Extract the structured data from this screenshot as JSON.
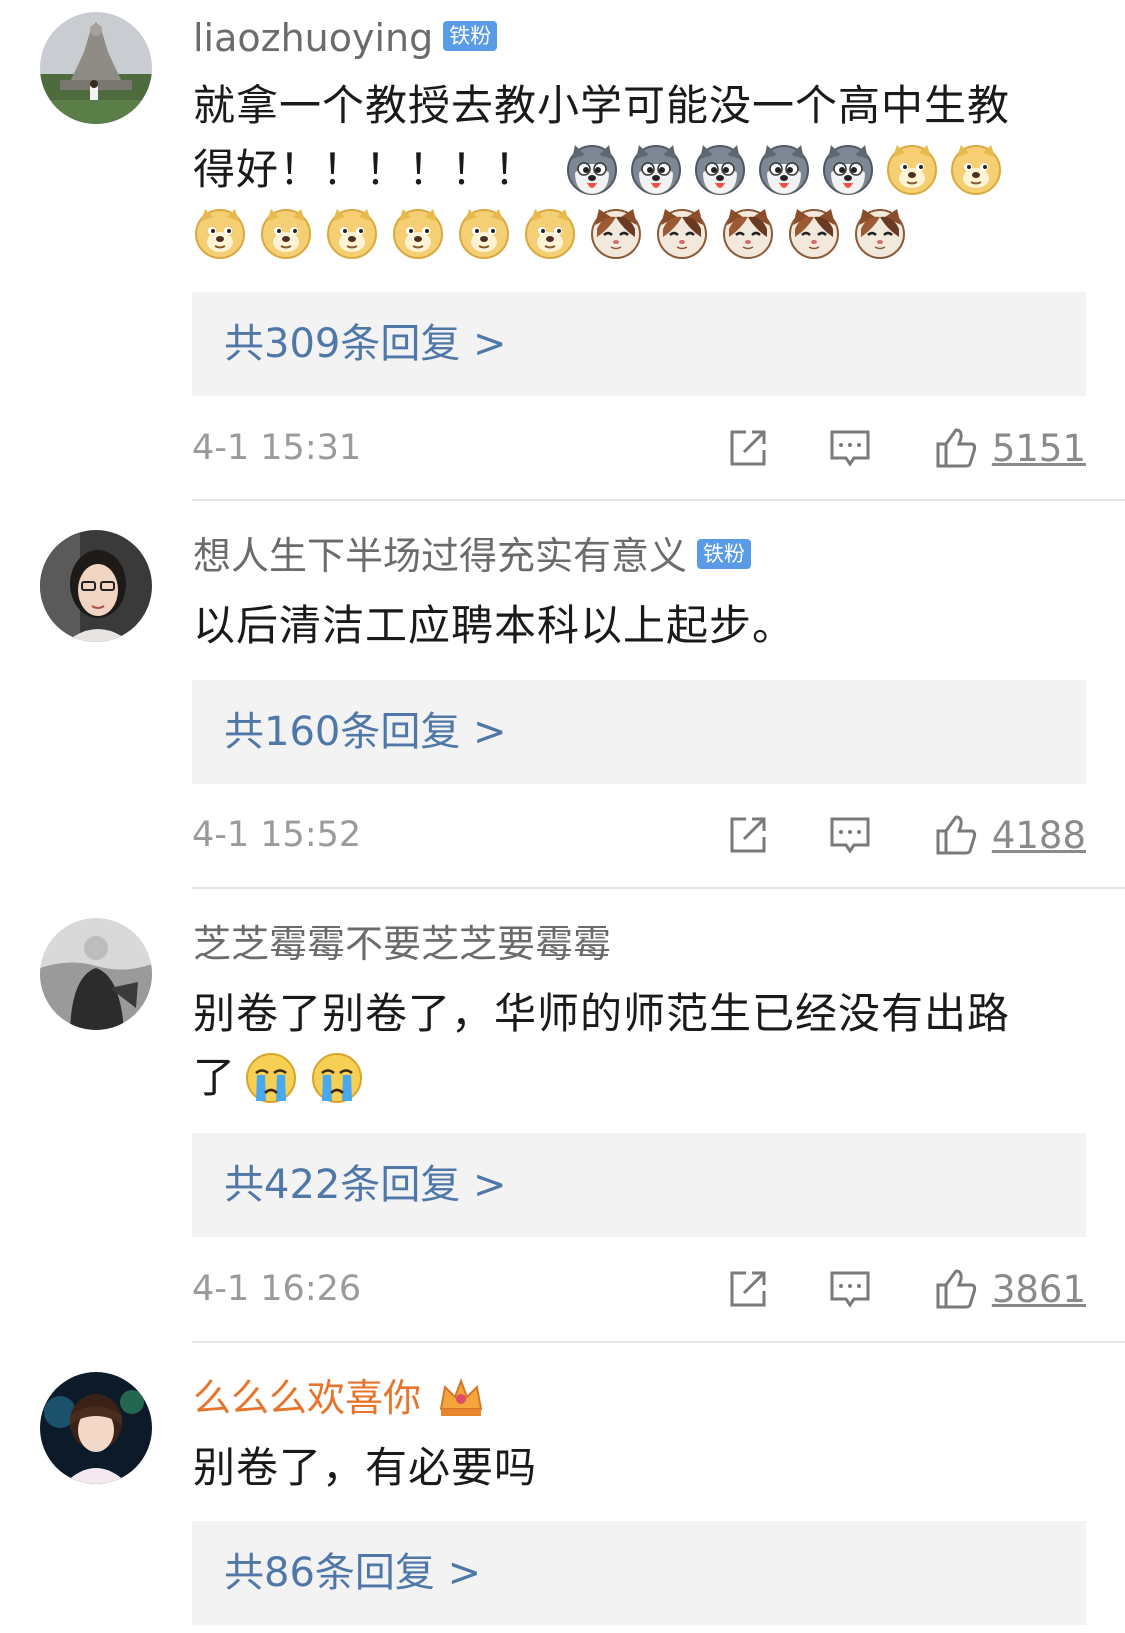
{
  "comments": [
    {
      "username": "liaozhuoying",
      "badge": "铁粉",
      "text_line1": "就拿一个教授去教小学可能没一个高中生教",
      "text_line2": "得好！！！！！！",
      "replies": "共309条回复 >",
      "time": "4-1 15:31",
      "likes": "5151",
      "emojis_row1": [
        "husky-emoji",
        "husky-emoji",
        "husky-emoji",
        "husky-emoji",
        "husky-emoji",
        "doge-emoji",
        "doge-emoji"
      ],
      "emojis_row2": [
        "doge-emoji",
        "doge-emoji",
        "doge-emoji",
        "doge-emoji",
        "doge-emoji",
        "doge-emoji",
        "cat-emoji",
        "cat-emoji",
        "cat-emoji",
        "cat-emoji",
        "cat-emoji"
      ]
    },
    {
      "username": "想人生下半场过得充实有意义",
      "badge": "铁粉",
      "text_line1": "以后清洁工应聘本科以上起步。",
      "replies": "共160条回复 >",
      "time": "4-1 15:52",
      "likes": "4188"
    },
    {
      "username": "芝芝霉霉不要芝芝要霉霉",
      "text_line1": "别卷了别卷了，华师的师范生已经没有出路",
      "text_line2": "了",
      "replies": "共422条回复 >",
      "time": "4-1 16:26",
      "likes": "3861",
      "emojis_row2": [
        "crying-emoji",
        "crying-emoji"
      ]
    },
    {
      "username": "么么么欢喜你",
      "text_line1": "别卷了，有必要吗",
      "replies": "共86条回复 >",
      "crown_icon": "crown-icon"
    }
  ],
  "colors": {
    "link_blue": "#4f77a8",
    "vip_orange": "#e8732a",
    "badge_blue": "#5a9be8",
    "reply_bg": "#f3f3f3"
  }
}
